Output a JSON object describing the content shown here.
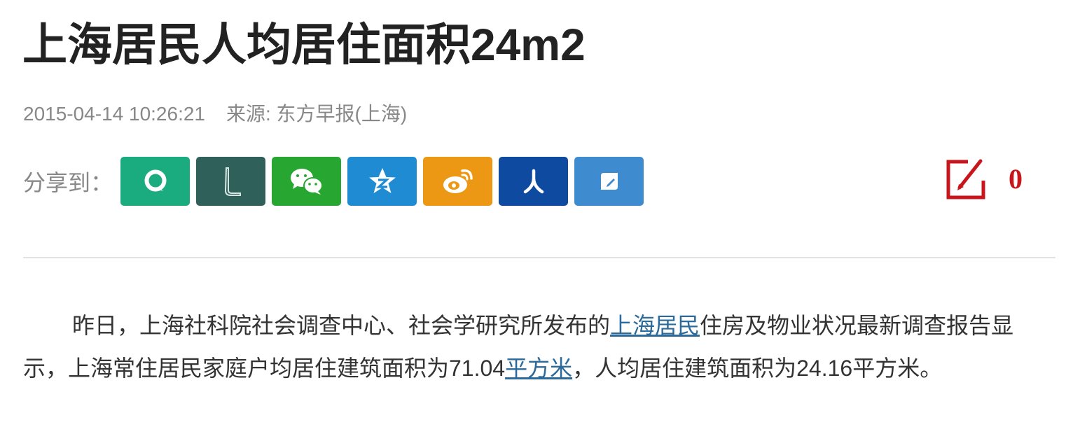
{
  "article": {
    "title": "上海居民人均居住面积24m2",
    "datetime": "2015-04-14 10:26:21",
    "source": "来源: 东方早报(上海)",
    "paragraph": {
      "text_1": "昨日，上海社科院社会调查中心、社会学研究所发布的",
      "link_1": "上海居民",
      "text_2": "住房及物业状况最新调查报告显示，上海常住居民家庭户均居住建筑面积为71.04",
      "link_2": "平方米",
      "text_3": "，人均居住建筑面积为24.16平方米。"
    }
  },
  "share": {
    "label": "分享到：",
    "buttons": [
      {
        "icon": "qzone-icon",
        "color": "#1aac7e"
      },
      {
        "icon": "l-icon",
        "color": "#30605a"
      },
      {
        "icon": "wechat-icon",
        "color": "#27a732"
      },
      {
        "icon": "qq-star-icon",
        "color": "#1f8bd3"
      },
      {
        "icon": "weibo-icon",
        "color": "#ed9815"
      },
      {
        "icon": "renren-icon",
        "color": "#0e4ba0"
      },
      {
        "icon": "edit-box-icon",
        "color": "#3e8ccf"
      }
    ]
  },
  "comment": {
    "count": "0",
    "color": "#c8161d"
  }
}
